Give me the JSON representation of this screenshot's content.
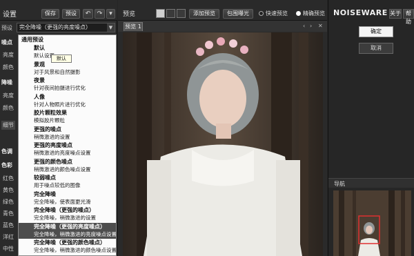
{
  "toolbar": {
    "settings_label": "设置",
    "save_label": "保存",
    "preset_label": "预设",
    "undo_icon": "undo-icon",
    "redo_icon": "redo-icon",
    "more_icon": "chevron-down-icon"
  },
  "preset": {
    "label": "预设",
    "selected": "完全降噪（更强的亮度噪点）"
  },
  "sidecol": {
    "items": [
      "噪点",
      "亮度",
      "颜色",
      "降噪",
      "亮度",
      "颜色",
      "细节",
      "色调",
      "色彩",
      "红色",
      "黄色",
      "绿色",
      "青色",
      "蓝色",
      "洋红",
      "中性"
    ]
  },
  "dropdown": {
    "header": "通用预设",
    "tooltip": "默认",
    "items": [
      {
        "title": "默认",
        "desc": "默认设置"
      },
      {
        "title": "景观",
        "desc": "对于风景和自然摄影"
      },
      {
        "title": "夜景",
        "desc": "针对夜间拍摄进行优化"
      },
      {
        "title": "人像",
        "desc": "针对人物照片进行优化"
      },
      {
        "title": "胶片颗粒效果",
        "desc": "模拟胶片颗粒"
      },
      {
        "title": "更强的噪点",
        "desc": "稍微激进的设置"
      },
      {
        "title": "更强的亮度噪点",
        "desc": "稍微激进的亮度噪点设置"
      },
      {
        "title": "更强的颜色噪点",
        "desc": "稍微激进的颜色噪点设置"
      },
      {
        "title": "较弱噪点",
        "desc": "用于噪点较低的图像"
      },
      {
        "title": "完全降噪",
        "desc": "完全降噪，使表面更光滑"
      },
      {
        "title": "完全降噪（更强的噪点）",
        "desc": "完全降噪，稍微激进的设置"
      },
      {
        "title": "完全降噪（更强的亮度噪点）",
        "desc": "完全降噪，稍微激进的亮度噪点设置"
      },
      {
        "title": "完全降噪（更强的颜色噪点）",
        "desc": "完全降噪，稍微激进的颜色噪点设置"
      }
    ],
    "selected_index": 11
  },
  "preview": {
    "label": "预览",
    "add_preview": "添加预览",
    "bracket_exposure": "包围曝光",
    "fast_preview": "快速预览",
    "accurate_preview": "精确预览",
    "tab": "预览 1",
    "tab_prev_icon": "chevron-left-icon",
    "tab_next_icon": "chevron-right-icon",
    "tab_close_icon": "close-icon"
  },
  "right": {
    "logo": "NOISEWARE 5",
    "about": "关于",
    "help": "帮助",
    "ok": "确定",
    "cancel": "取消",
    "navigator": "导航"
  }
}
